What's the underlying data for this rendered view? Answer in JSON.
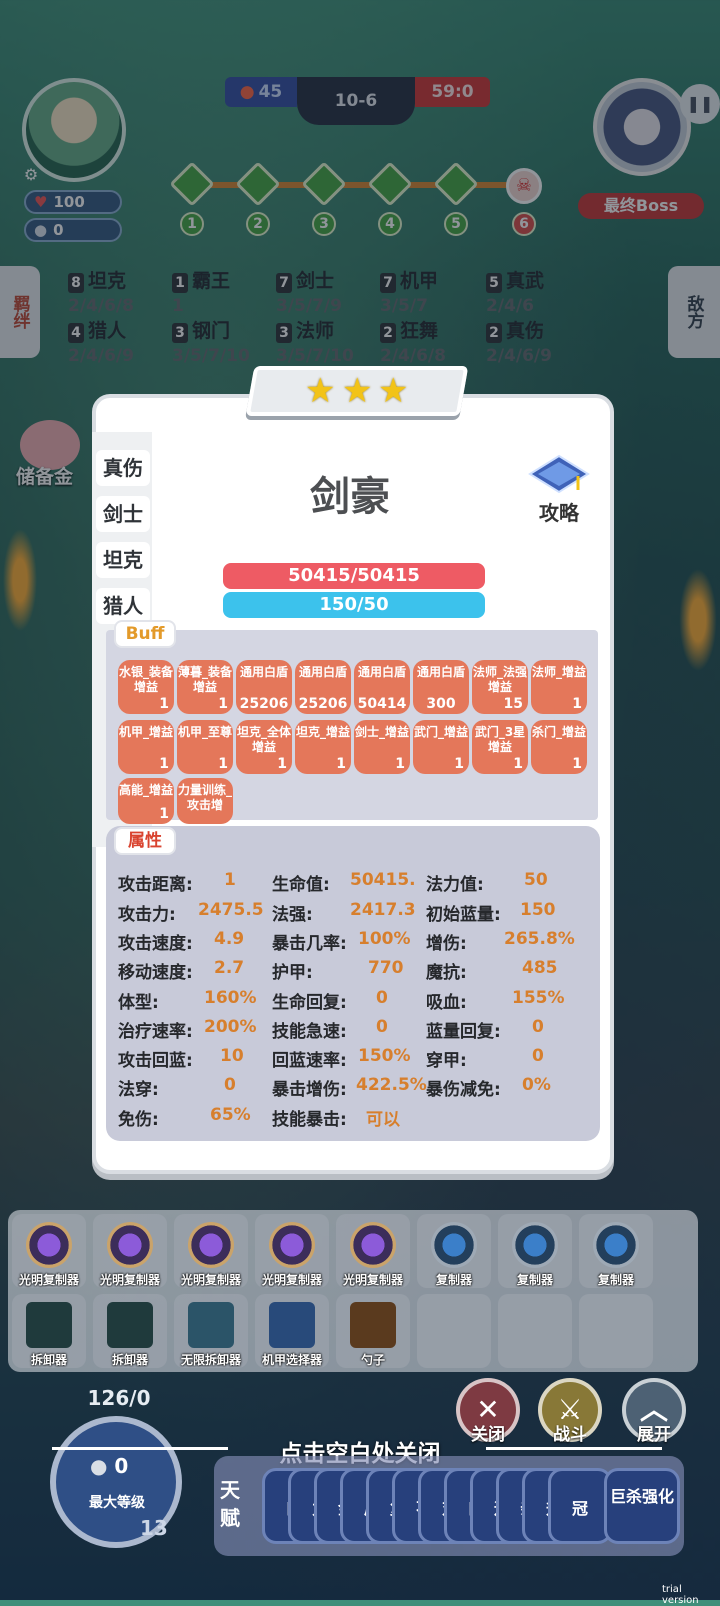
{
  "hud": {
    "player_hp": "100",
    "player_coins": "0",
    "left_score": "45",
    "round": "10-6",
    "right_score": "59:0",
    "stages": [
      "1",
      "2",
      "3",
      "4",
      "5",
      "6"
    ],
    "boss_label": "最终Boss",
    "side_left": "羁绊",
    "side_right": "敌方",
    "piggy_label": "储备金"
  },
  "synergies": [
    {
      "n": "8",
      "name": "坦克",
      "levels": "2/4/6/8"
    },
    {
      "n": "1",
      "name": "霸王",
      "levels": "1"
    },
    {
      "n": "7",
      "name": "剑士",
      "levels": "3/5/7/9"
    },
    {
      "n": "7",
      "name": "机甲",
      "levels": "3/5/7"
    },
    {
      "n": "5",
      "name": "真武",
      "levels": "2/4/6"
    },
    {
      "n": "4",
      "name": "猎人",
      "levels": "2/4/6/9"
    },
    {
      "n": "3",
      "name": "钢门",
      "levels": "3/5/7/10"
    },
    {
      "n": "3",
      "name": "法师",
      "levels": "3/5/7/10"
    },
    {
      "n": "2",
      "name": "狂舞",
      "levels": "2/4/6/8"
    },
    {
      "n": "2",
      "name": "真伤",
      "levels": "2/4/6/9"
    }
  ],
  "modal": {
    "stars": 3,
    "unit_name": "剑豪",
    "guide_label": "攻略",
    "hp": "50415/50415",
    "mp": "150/50",
    "left_tabs": [
      "真伤",
      "剑士",
      "坦克",
      "猎人"
    ],
    "buff_title": "Buff",
    "attr_title": "属性",
    "buffs": [
      {
        "name": "水银_装备增益",
        "val": "1"
      },
      {
        "name": "薄暮_装备增益",
        "val": "1"
      },
      {
        "name": "通用白盾",
        "val": "25206"
      },
      {
        "name": "通用白盾",
        "val": "25206"
      },
      {
        "name": "通用白盾",
        "val": "50414"
      },
      {
        "name": "通用白盾",
        "val": "300"
      },
      {
        "name": "法师_法强增益",
        "val": "15"
      },
      {
        "name": "法师_增益",
        "val": "1"
      },
      {
        "name": "机甲_增益",
        "val": "1"
      },
      {
        "name": "机甲_至尊",
        "val": "1"
      },
      {
        "name": "坦克_全体增益",
        "val": "1"
      },
      {
        "name": "坦克_增益",
        "val": "1"
      },
      {
        "name": "剑士_增益",
        "val": "1"
      },
      {
        "name": "武门_增益",
        "val": "1"
      },
      {
        "name": "武门_3星增益",
        "val": "1"
      },
      {
        "name": "杀门_增益",
        "val": "1"
      },
      {
        "name": "高能_增益",
        "val": "1"
      },
      {
        "name": "力量训练_攻击增",
        "val": ""
      }
    ],
    "attributes": [
      [
        {
          "k": "攻击距离:",
          "v": "1"
        },
        {
          "k": "生命值:",
          "v": "50415."
        },
        {
          "k": "法力值:",
          "v": "50"
        }
      ],
      [
        {
          "k": "攻击力:",
          "v": "2475.5"
        },
        {
          "k": "法强:",
          "v": "2417.3"
        },
        {
          "k": "初始蓝量:",
          "v": "150"
        }
      ],
      [
        {
          "k": "攻击速度:",
          "v": "4.9"
        },
        {
          "k": "暴击几率:",
          "v": "100%"
        },
        {
          "k": "增伤:",
          "v": "265.8%"
        }
      ],
      [
        {
          "k": "移动速度:",
          "v": "2.7"
        },
        {
          "k": "护甲:",
          "v": "770"
        },
        {
          "k": "魔抗:",
          "v": "485"
        }
      ],
      [
        {
          "k": "体型:",
          "v": "160%"
        },
        {
          "k": "生命回复:",
          "v": "0"
        },
        {
          "k": "吸血:",
          "v": "155%"
        }
      ],
      [
        {
          "k": "治疗速率:",
          "v": "200%"
        },
        {
          "k": "技能急速:",
          "v": "0"
        },
        {
          "k": "蓝量回复:",
          "v": "0"
        }
      ],
      [
        {
          "k": "攻击回蓝:",
          "v": "10"
        },
        {
          "k": "回蓝速率:",
          "v": "150%"
        },
        {
          "k": "穿甲:",
          "v": "0"
        }
      ],
      [
        {
          "k": "法穿:",
          "v": "0"
        },
        {
          "k": "暴击增伤:",
          "v": "422.5%"
        },
        {
          "k": "暴伤减免:",
          "v": "0%"
        }
      ],
      [
        {
          "k": "免伤:",
          "v": "65%"
        },
        {
          "k": "技能暴击:",
          "v": "可以"
        }
      ]
    ]
  },
  "inventory": {
    "row1": [
      "光明复制器",
      "光明复制器",
      "光明复制器",
      "光明复制器",
      "光明复制器",
      "复制器",
      "复制器",
      "复制器"
    ],
    "row2": [
      "拆卸器",
      "拆卸器",
      "无限拆卸器",
      "机甲选择器",
      "勺子",
      "",
      "",
      ""
    ]
  },
  "bottom": {
    "exp": "126/0",
    "level_coins": "0",
    "level_label": "最大等级",
    "level_num": "13",
    "close_tip": "点击空白处关闭",
    "btn_close": "关闭",
    "btn_fight": "战斗",
    "btn_expand": "展开",
    "talent_label": "天赋",
    "talent_chips": [
      "口",
      "力",
      "金",
      "后",
      "复",
      "不",
      "对",
      "口",
      "运",
      "亲",
      "升",
      "冠"
    ],
    "talent_last": "巨杀强化",
    "watermark": "trial version"
  },
  "colors": {
    "hp": "#ee5b64",
    "mp": "#3cc2ec",
    "buff": "#e4775a",
    "value": "#d77f2d"
  }
}
